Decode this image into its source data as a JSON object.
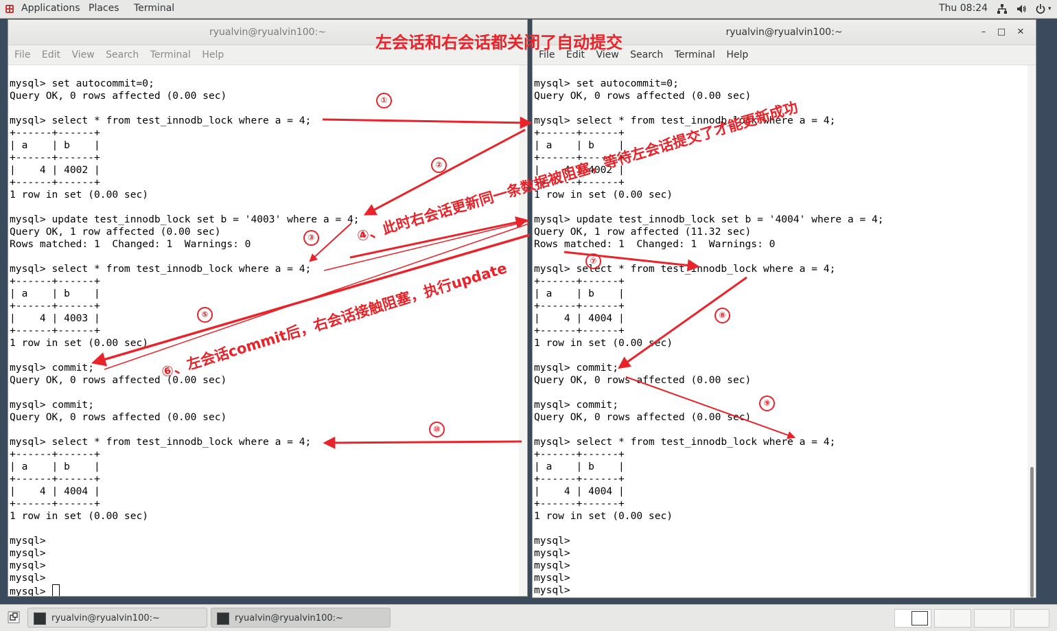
{
  "topbar": {
    "applications": "Applications",
    "places": "Places",
    "terminal": "Terminal",
    "clock": "Thu 08:24"
  },
  "left_window": {
    "title": "ryualvin@ryualvin100:~",
    "menu": [
      "File",
      "Edit",
      "View",
      "Search",
      "Terminal",
      "Help"
    ],
    "lines": [
      "",
      "mysql> set autocommit=0;",
      "Query OK, 0 rows affected (0.00 sec)",
      "",
      "mysql> select * from test_innodb_lock where a = 4;",
      "+------+------+",
      "| a    | b    |",
      "+------+------+",
      "|    4 | 4002 |",
      "+------+------+",
      "1 row in set (0.00 sec)",
      "",
      "mysql> update test_innodb_lock set b = '4003' where a = 4;",
      "Query OK, 1 row affected (0.00 sec)",
      "Rows matched: 1  Changed: 1  Warnings: 0",
      "",
      "mysql> select * from test_innodb_lock where a = 4;",
      "+------+------+",
      "| a    | b    |",
      "+------+------+",
      "|    4 | 4003 |",
      "+------+------+",
      "1 row in set (0.00 sec)",
      "",
      "mysql> commit;",
      "Query OK, 0 rows affected (0.00 sec)",
      "",
      "mysql> commit;",
      "Query OK, 0 rows affected (0.00 sec)",
      "",
      "mysql> select * from test_innodb_lock where a = 4;",
      "+------+------+",
      "| a    | b    |",
      "+------+------+",
      "|    4 | 4004 |",
      "+------+------+",
      "1 row in set (0.00 sec)",
      "",
      "mysql>",
      "mysql>",
      "mysql>",
      "mysql>"
    ],
    "prompt_line": "mysql> "
  },
  "right_window": {
    "title": "ryualvin@ryualvin100:~",
    "menu": [
      "File",
      "Edit",
      "View",
      "Search",
      "Terminal",
      "Help"
    ],
    "lines": [
      "",
      "mysql> set autocommit=0;",
      "Query OK, 0 rows affected (0.00 sec)",
      "",
      "mysql> select * from test_innodb_lock where a = 4;",
      "+------+------+",
      "| a    | b    |",
      "+------+------+",
      "|    4 | 4002 |",
      "+------+------+",
      "1 row in set (0.00 sec)",
      "",
      "mysql> update test_innodb_lock set b = '4004' where a = 4;",
      "Query OK, 1 row affected (11.32 sec)",
      "Rows matched: 1  Changed: 1  Warnings: 0",
      "",
      "mysql> select * from test_innodb_lock where a = 4;",
      "+------+------+",
      "| a    | b    |",
      "+------+------+",
      "|    4 | 4004 |",
      "+------+------+",
      "1 row in set (0.00 sec)",
      "",
      "mysql> commit;",
      "Query OK, 0 rows affected (0.00 sec)",
      "",
      "mysql> commit;",
      "Query OK, 0 rows affected (0.00 sec)",
      "",
      "mysql> select * from test_innodb_lock where a = 4;",
      "+------+------+",
      "| a    | b    |",
      "+------+------+",
      "|    4 | 4004 |",
      "+------+------+",
      "1 row in set (0.00 sec)",
      "",
      "mysql>",
      "mysql>",
      "mysql>",
      "mysql>",
      "mysql>"
    ]
  },
  "annotations": {
    "headline": "左会话和右会话都关闭了自动提交",
    "note_4": "④、此时右会话更新同一条数据被阻塞，等待左会话提交了才能更新成功",
    "note_6": "⑥、左会话commit后，右会话接触阻塞，执行update",
    "markers": [
      "①",
      "②",
      "③",
      "⑤",
      "⑦",
      "⑧",
      "⑨",
      "⑩"
    ]
  },
  "taskbar": {
    "task1": "ryualvin@ryualvin100:~",
    "task2": "ryualvin@ryualvin100:~"
  },
  "colors": {
    "annotation": "#e8232a",
    "desktop": "#3b4a5c",
    "terminal_bg": "#ffffff"
  }
}
